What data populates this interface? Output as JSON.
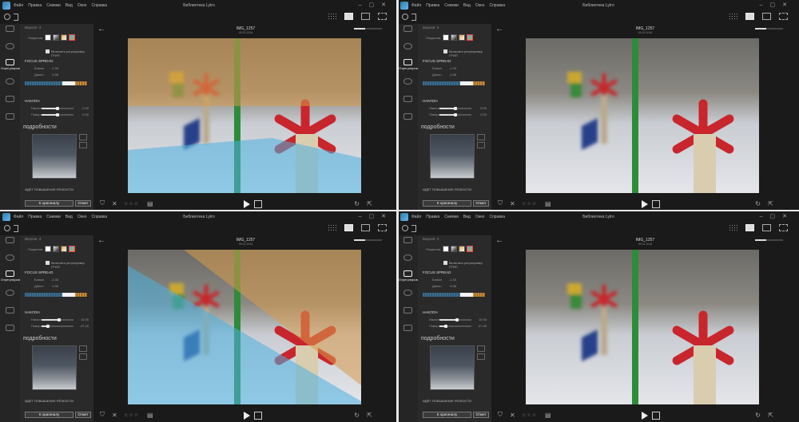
{
  "window": {
    "title": "Библиотека Lytro",
    "menu": [
      "Файл",
      "Правка",
      "Снимки",
      "Вид",
      "Окно",
      "Справка"
    ]
  },
  "rail": {
    "items": [
      {
        "label": "",
        "icon": "library-icon"
      },
      {
        "label": "",
        "icon": "info-icon"
      },
      {
        "label": "Отрегулиров",
        "icon": "sliders-icon"
      },
      {
        "label": "",
        "icon": "share-icon"
      },
      {
        "label": "",
        "icon": "film-icon"
      },
      {
        "label": "",
        "icon": "screen-icon"
      }
    ]
  },
  "panel": {
    "version_label": "Версия: 3",
    "overlay_label": "Покрытие:",
    "focus_spread_title": "FOCUS SPREAD",
    "checkbox_label": "Включить регулировку ГРИП",
    "near_label": "Ближн",
    "near_value": "-1.33",
    "far_label": "Дальн",
    "far_value": "4.56",
    "tilt_title": "НАКЛОН",
    "tilt_h_label": "Наклон",
    "tilt_v_label": "Поворот",
    "details_title": "подробности",
    "sharpen_label": "ИДЁТ ПОВЫШЕНИЕ РЕЗКОСТИ",
    "original_button": "К оригиналу",
    "cancel_button": "Отмет"
  },
  "quadrants": [
    {
      "tilt_h_value": "0.00",
      "tilt_v_value": "0.00",
      "tilt_h_pos": 0.5,
      "tilt_v_pos": 0.5,
      "overlay": "bands"
    },
    {
      "tilt_h_value": "0.00",
      "tilt_v_value": "0.00",
      "tilt_h_pos": 0.5,
      "tilt_v_pos": 0.5,
      "overlay": "none"
    },
    {
      "tilt_h_value": "10.00",
      "tilt_v_value": "-47.40",
      "tilt_h_pos": 0.55,
      "tilt_v_pos": 0.2,
      "overlay": "diagonal"
    },
    {
      "tilt_h_value": "10.00",
      "tilt_v_value": "-47.40",
      "tilt_h_pos": 0.55,
      "tilt_v_pos": 0.2,
      "overlay": "none"
    }
  ],
  "viewer": {
    "image_name": "IMG_1257",
    "image_date": "09.01.2016",
    "stars": "☆☆☆",
    "zoom_level": 0.4
  },
  "colors": {
    "overlay_blue": "#4ab0e0",
    "overlay_orange": "#d89a4a",
    "toy_red": "#c8262c",
    "stick_green": "#2e8b3a"
  }
}
